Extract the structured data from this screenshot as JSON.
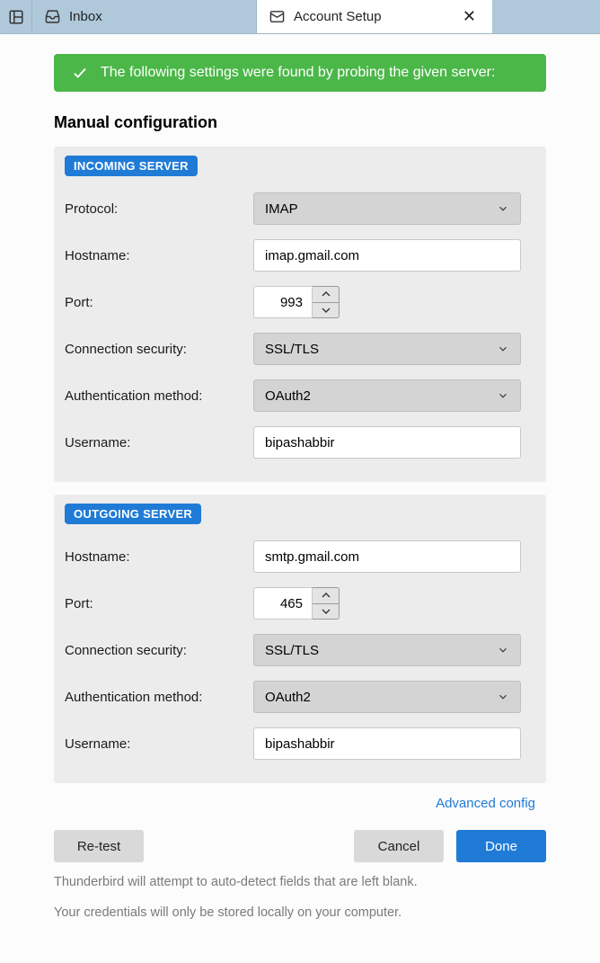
{
  "tabs": {
    "inbox": "Inbox",
    "account_setup": "Account Setup"
  },
  "banner": {
    "text": "The following settings were found by probing the given server:"
  },
  "title": "Manual configuration",
  "incoming": {
    "badge": "INCOMING SERVER",
    "protocol_label": "Protocol:",
    "protocol_value": "IMAP",
    "hostname_label": "Hostname:",
    "hostname_value": "imap.gmail.com",
    "port_label": "Port:",
    "port_value": "993",
    "security_label": "Connection security:",
    "security_value": "SSL/TLS",
    "auth_label": "Authentication method:",
    "auth_value": "OAuth2",
    "username_label": "Username:",
    "username_value": "bipashabbir"
  },
  "outgoing": {
    "badge": "OUTGOING SERVER",
    "hostname_label": "Hostname:",
    "hostname_value": "smtp.gmail.com",
    "port_label": "Port:",
    "port_value": "465",
    "security_label": "Connection security:",
    "security_value": "SSL/TLS",
    "auth_label": "Authentication method:",
    "auth_value": "OAuth2",
    "username_label": "Username:",
    "username_value": "bipashabbir"
  },
  "advanced_link": "Advanced config",
  "buttons": {
    "retest": "Re-test",
    "cancel": "Cancel",
    "done": "Done"
  },
  "hints": {
    "autodetect": "Thunderbird will attempt to auto-detect fields that are left blank.",
    "credentials": "Your credentials will only be stored locally on your computer."
  }
}
